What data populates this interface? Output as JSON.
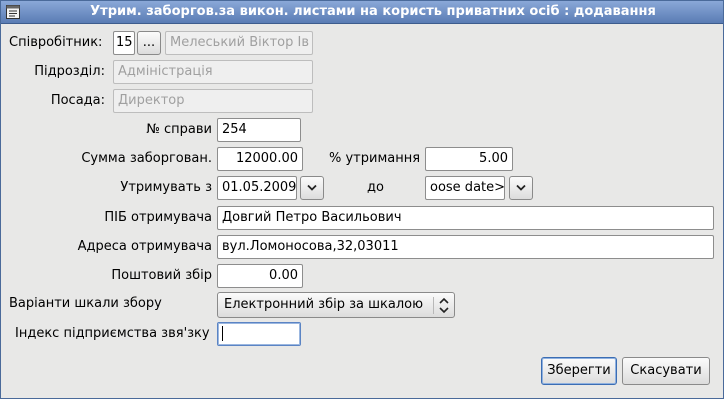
{
  "window": {
    "title": "Утрим. заборгов.за викон. листами на користь приватних осіб : додавання",
    "icon": "form-icon"
  },
  "employee": {
    "label": "Співробітник:",
    "id_value": "15",
    "picker_label": "...",
    "name_value": "Мелеський Віктор Ів"
  },
  "department": {
    "label": "Підрозділ:",
    "value": "Адміністрація"
  },
  "position": {
    "label": "Посада:",
    "value": "Директор"
  },
  "case_number": {
    "label": "№ справи",
    "value": "254"
  },
  "debt_sum": {
    "label": "Сумма заборгован.",
    "value": "12000.00"
  },
  "withhold_percent": {
    "label": "% утримання",
    "value": "5.00"
  },
  "withhold_from": {
    "label": "Утримувать з",
    "value": "01.05.2009"
  },
  "withhold_to": {
    "label": "до",
    "value": "oose date>"
  },
  "recipient_name": {
    "label": "ПІБ отримувача",
    "value": "Довгий Петро Васильович"
  },
  "recipient_address": {
    "label": "Адреса отримувача",
    "value": "вул.Ломоносова,32,03011"
  },
  "postal_fee": {
    "label": "Поштовий збір",
    "value": "0.00"
  },
  "fee_scale": {
    "label": "Варіанти шкали збору",
    "value": "Електронний збір за шкалою"
  },
  "post_index": {
    "label": "Індекс підприємства звя'зку",
    "value": ""
  },
  "buttons": {
    "save": "Зберегти",
    "cancel": "Скасувати"
  },
  "colors": {
    "titlebar": "#6f90c8",
    "background": "#e8e8e7",
    "focus": "#5b84c4"
  }
}
